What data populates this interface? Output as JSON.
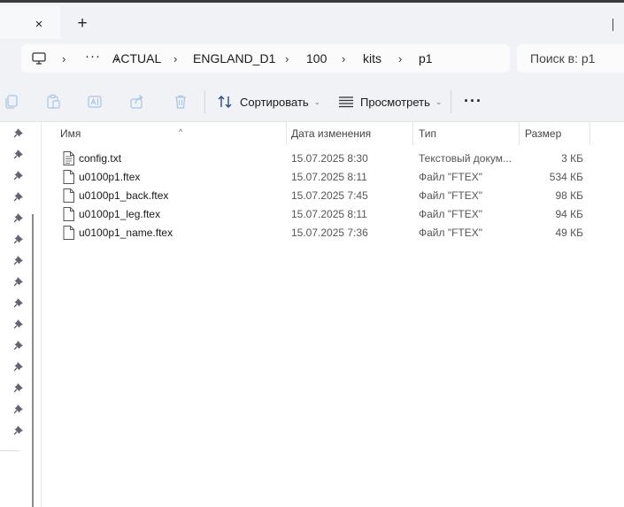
{
  "tabs": {
    "close_symbol": "×",
    "new_tab_symbol": "+"
  },
  "breadcrumb": {
    "overflow": "···",
    "items": [
      "ACTUAL",
      "ENGLAND_D1",
      "100",
      "kits",
      "p1"
    ],
    "separator": "›"
  },
  "search": {
    "placeholder": "Поиск в: p1"
  },
  "toolbar": {
    "sort_label": "Сортировать",
    "view_label": "Просмотреть",
    "more_label": "···",
    "caret": "⌄"
  },
  "columns": {
    "name": "Имя",
    "date": "Дата изменения",
    "type": "Тип",
    "size": "Размер",
    "sort_indicator": "^"
  },
  "files": [
    {
      "name": "config.txt",
      "date": "15.07.2025 8:30",
      "type": "Текстовый докум...",
      "size": "3 КБ",
      "icon": "text-file-icon"
    },
    {
      "name": "u0100p1.ftex",
      "date": "15.07.2025 8:11",
      "type": "Файл \"FTEX\"",
      "size": "534 КБ",
      "icon": "file-icon"
    },
    {
      "name": "u0100p1_back.ftex",
      "date": "15.07.2025 7:45",
      "type": "Файл \"FTEX\"",
      "size": "98 КБ",
      "icon": "file-icon"
    },
    {
      "name": "u0100p1_leg.ftex",
      "date": "15.07.2025 8:11",
      "type": "Файл \"FTEX\"",
      "size": "94 КБ",
      "icon": "file-icon"
    },
    {
      "name": "u0100p1_name.ftex",
      "date": "15.07.2025 7:36",
      "type": "Файл \"FTEX\"",
      "size": "49 КБ",
      "icon": "file-icon"
    }
  ],
  "nav_pins": 15,
  "colors": {
    "chrome_bg": "#f0f2f5",
    "pin": "#5f6470",
    "icon_disabled": "#a9c6e8"
  }
}
